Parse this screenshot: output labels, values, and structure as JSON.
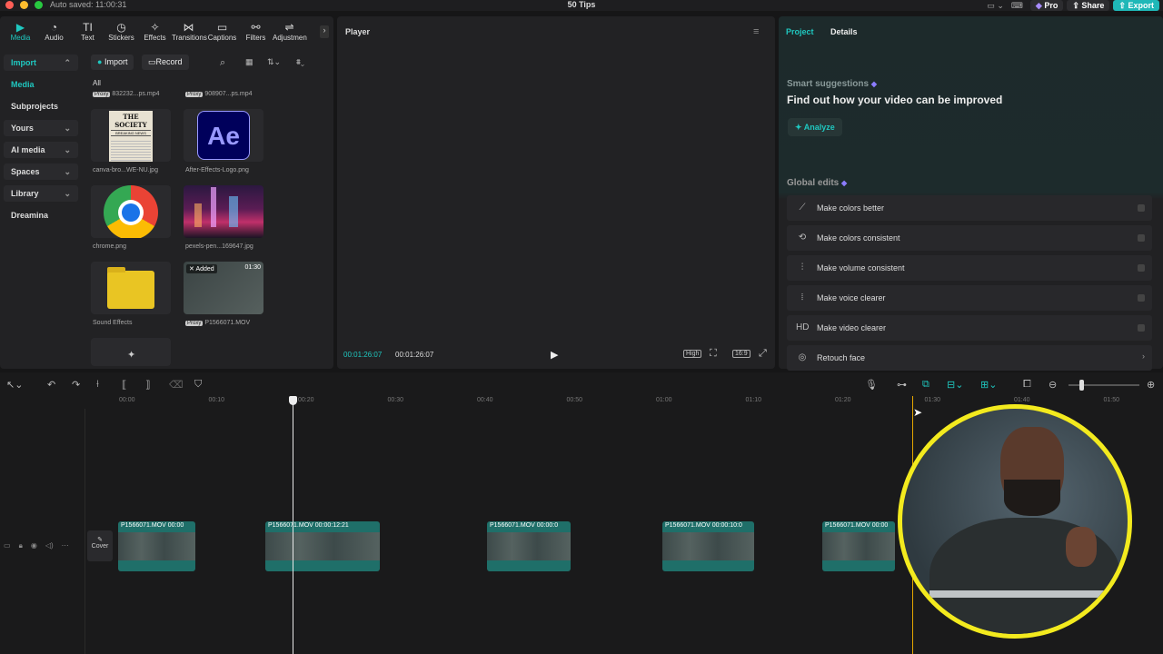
{
  "titlebar": {
    "autosave": "Auto saved: 11:00:31",
    "project_title": "50 Tips",
    "pro_label": "Pro",
    "share_label": "Share",
    "export_label": "Export"
  },
  "toolbar_tabs": [
    {
      "label": "Media",
      "icon": "media-icon",
      "glyph": "▶"
    },
    {
      "label": "Audio",
      "icon": "audio-icon",
      "glyph": "◔"
    },
    {
      "label": "Text",
      "icon": "text-icon",
      "glyph": "TI"
    },
    {
      "label": "Stickers",
      "icon": "stickers-icon",
      "glyph": "◷"
    },
    {
      "label": "Effects",
      "icon": "effects-icon",
      "glyph": "✧"
    },
    {
      "label": "Transitions",
      "icon": "transitions-icon",
      "glyph": "⋈"
    },
    {
      "label": "Captions",
      "icon": "captions-icon",
      "glyph": "▭"
    },
    {
      "label": "Filters",
      "icon": "filters-icon",
      "glyph": "⚯"
    },
    {
      "label": "Adjustmen",
      "icon": "adjustment-icon",
      "glyph": "⇌"
    }
  ],
  "sidebar": {
    "items": [
      {
        "label": "Import",
        "chev": "⌃"
      },
      {
        "label": "Media",
        "chev": ""
      },
      {
        "label": "Subprojects",
        "chev": ""
      },
      {
        "label": "Yours",
        "chev": "⌄"
      },
      {
        "label": "AI media",
        "chev": "⌄"
      },
      {
        "label": "Spaces",
        "chev": "⌄"
      },
      {
        "label": "Library",
        "chev": "⌄"
      },
      {
        "label": "Dreamina",
        "chev": ""
      }
    ]
  },
  "media": {
    "import_label": "Import",
    "record_label": "Record",
    "filter_all": "All",
    "proxy_tag": "Proxy",
    "top_file_1": "832232...ps.mp4",
    "top_file_2": "908907...ps.mp4",
    "tiles": [
      {
        "caption": "canva-bro...WE-NU.jpg",
        "headline": "THE SOCIETY",
        "sub": "BREAKING NEWS"
      },
      {
        "caption": "After-Effects-Logo.png",
        "logo_text": "Ae"
      },
      {
        "caption": "chrome.png"
      },
      {
        "caption": "pexels-pen...169647.jpg"
      },
      {
        "caption": "Sound Effects"
      },
      {
        "caption": "P1566071.MOV",
        "added": "Added",
        "duration": "01:30"
      }
    ]
  },
  "player": {
    "title": "Player",
    "current_time": "00:01:26:07",
    "total_time": "00:01:26:07",
    "quality": "High",
    "ratio": "16:9"
  },
  "right_panel": {
    "tab_project": "Project",
    "tab_details": "Details",
    "smart_title": "Smart suggestions",
    "smart_heading": "Find out how your video can be improved",
    "analyze_label": "Analyze",
    "global_title": "Global edits",
    "edits": [
      {
        "label": "Make colors better",
        "icon": "magic-wand-icon",
        "glyph": "⟋"
      },
      {
        "label": "Make colors consistent",
        "icon": "color-sync-icon",
        "glyph": "⟲"
      },
      {
        "label": "Make volume consistent",
        "icon": "sliders-icon",
        "glyph": "⫶"
      },
      {
        "label": "Make voice clearer",
        "icon": "waveform-icon",
        "glyph": "⦙"
      },
      {
        "label": "Make video clearer",
        "icon": "hd-icon",
        "glyph": "HD"
      },
      {
        "label": "Retouch face",
        "icon": "face-icon",
        "glyph": "◎"
      }
    ]
  },
  "timeline": {
    "ruler": [
      "00:00",
      "00:10",
      "00:20",
      "00:30",
      "00:40",
      "00:50",
      "01:00",
      "01:10",
      "01:20",
      "01:30",
      "01:40",
      "01:50"
    ],
    "cover_label": "Cover",
    "clips": [
      {
        "label": "P1566071.MOV  00:00"
      },
      {
        "label": "P1566071.MOV  00:00:12:21"
      },
      {
        "label": "P1566071.MOV  00:00:0"
      },
      {
        "label": "P1566071.MOV  00:00:10:0"
      },
      {
        "label": "P1566071.MOV  00:00"
      }
    ]
  },
  "colors": {
    "accent": "#1fc8c0",
    "clip": "#1f6f69",
    "highlight_ring": "#f3ea1e",
    "marker": "#e6a600"
  }
}
